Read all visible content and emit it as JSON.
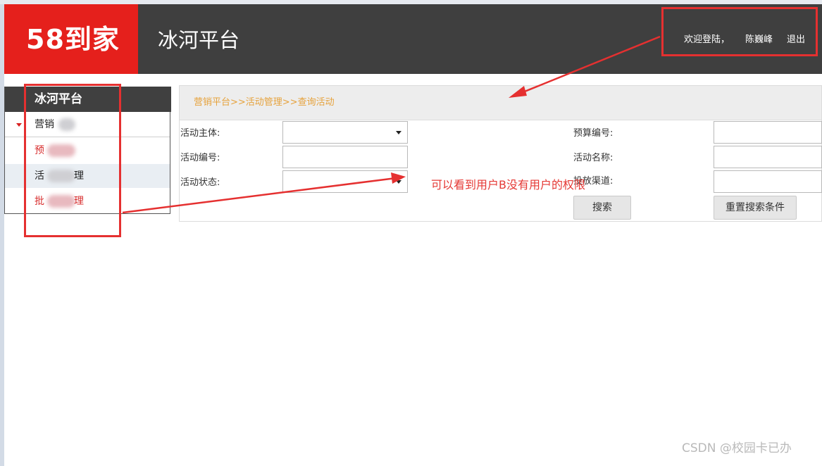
{
  "header": {
    "logo_text": "58到家",
    "platform_title": "冰河平台",
    "welcome": "欢迎登陆，",
    "username": "陈巍峰",
    "logout": "退出"
  },
  "sidebar": {
    "title": "冰河平台",
    "items": [
      {
        "label": "营销"
      },
      {
        "label": "预"
      },
      {
        "label": "活"
      },
      {
        "label": "批"
      }
    ],
    "items_suffix": [
      "",
      "",
      "理",
      "理"
    ]
  },
  "breadcrumb": "营销平台>>活动管理>>查询活动",
  "form": {
    "labels": {
      "subject": "活动主体:",
      "activity_no": "活动编号:",
      "status": "活动状态:",
      "budget_no": "预算编号:",
      "activity_name": "活动名称:",
      "invest_channel": "投放渠道:"
    },
    "values": {
      "subject": "",
      "activity_no": "",
      "status": "",
      "budget_no": "",
      "activity_name": "",
      "invest_channel": ""
    },
    "search_button": "搜索",
    "reset_button": "重置搜索条件"
  },
  "annotation": "可以看到用户B没有用户的权限",
  "watermark": "CSDN @校园卡已办",
  "colors": {
    "brand_red": "#e5201c",
    "header_bg": "#3f3f3f",
    "breadcrumb": "#e6a23c",
    "annotation_red": "#e53030"
  }
}
